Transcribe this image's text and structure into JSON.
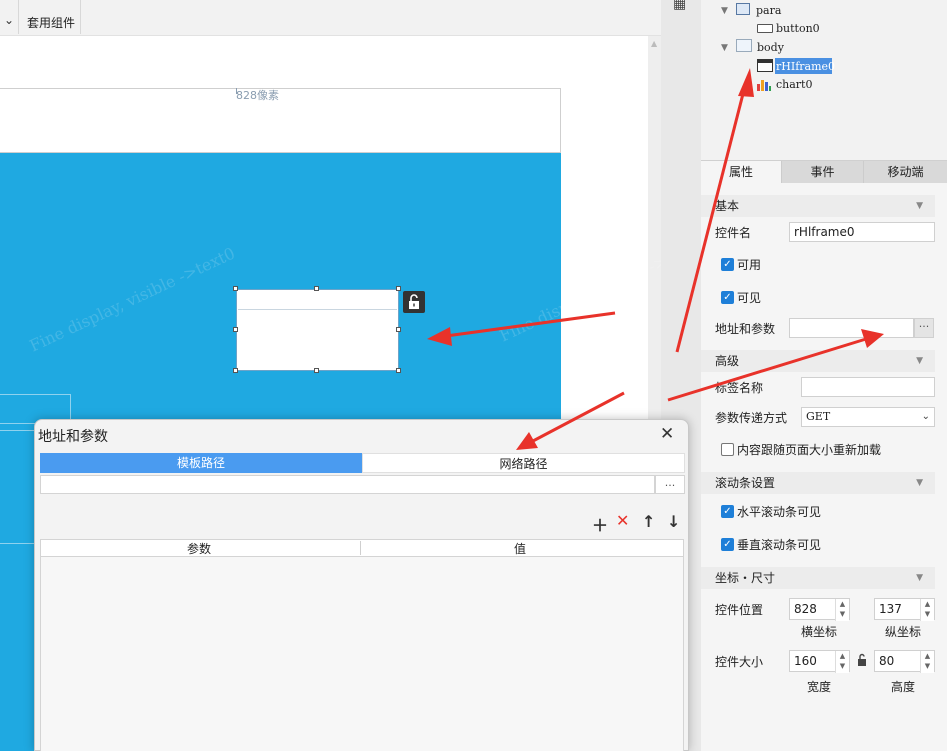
{
  "toolbar": {
    "tab_label": "套用组件"
  },
  "canvas": {
    "ruler_label": "828像素",
    "watermark_text": "Fine display, visible ->text0"
  },
  "tree": {
    "nodes": [
      {
        "label": "para"
      },
      {
        "label": "button0"
      },
      {
        "label": "body"
      },
      {
        "label": "rHIframe0"
      },
      {
        "label": "chart0"
      }
    ]
  },
  "panel": {
    "tabs": [
      "属性",
      "事件",
      "移动端"
    ],
    "section_basic": "基本",
    "name_label": "控件名",
    "name_value": "rHlframe0",
    "enabled_label": "可用",
    "visible_label": "可见",
    "url_label": "地址和参数",
    "url_button": "···",
    "section_advanced": "高级",
    "tag_label": "标签名称",
    "method_label": "参数传递方式",
    "method_value": "GET",
    "reload_label": "内容跟随页面大小重新加载",
    "section_scroll": "滚动条设置",
    "hscroll_label": "水平滚动条可见",
    "vscroll_label": "垂直滚动条可见",
    "section_coord": "坐标・尺寸",
    "pos_label": "控件位置",
    "pos_x": "828",
    "pos_y": "137",
    "x_label": "横坐标",
    "y_label": "纵坐标",
    "size_label": "控件大小",
    "width_value": "160",
    "height_value": "80",
    "width_label": "宽度",
    "height_label": "高度"
  },
  "dialog": {
    "title": "地址和参数",
    "tab_template": "模板路径",
    "tab_network": "网络路径",
    "path_button": "...",
    "col_param": "参数",
    "col_value": "值"
  },
  "colors": {
    "accent_blue": "#4a9bf0",
    "canvas_blue": "#1fa9e1",
    "arrow_red": "#e8322a"
  }
}
